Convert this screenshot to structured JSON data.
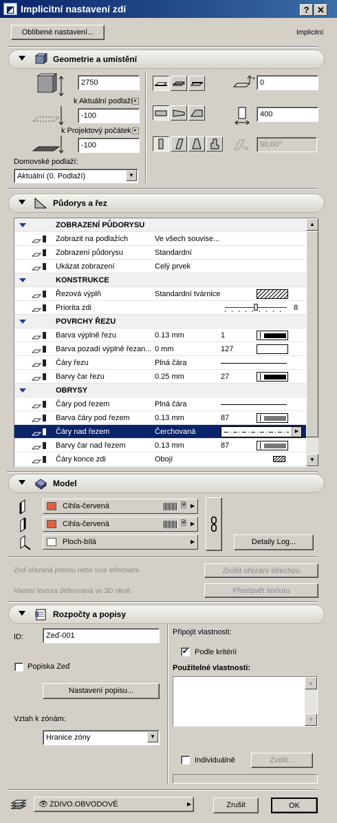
{
  "window": {
    "title": "Implicitní nastavení zdí",
    "help": "?",
    "close": "✕"
  },
  "top": {
    "favorites_label": "Oblíbené nastavení...",
    "mode": "Implicitní"
  },
  "sections": {
    "geometry": "Geometrie a umístění",
    "floorplan": "Půdorys a řez",
    "model": "Model",
    "budget": "Rozpočty a popisy"
  },
  "geometry": {
    "height": "2750",
    "top_link": "k Aktuální podlaží",
    "top_offset": "-100",
    "bottom_link": "k Projektový počátek",
    "bottom_offset": "-100",
    "home_story_label": "Domovské podlaží:",
    "home_story_value": "Aktuální (0. Podlaží)",
    "offset_value": "0",
    "thickness": "400",
    "angle": "90,00°"
  },
  "grid": {
    "rows": [
      {
        "type": "header",
        "name": "ZOBRAZENÍ PŮDORYSU"
      },
      {
        "type": "row",
        "name": "Zobrazit na podlažích",
        "value": "Ve všech souvise...",
        "icon": "stories-icon"
      },
      {
        "type": "row",
        "name": "Zobrazení půdorysu",
        "value": "Standardní",
        "icon": "view-icon"
      },
      {
        "type": "row",
        "name": "Ukázat zobrazení",
        "value": "Celý prvek",
        "icon": "show-icon"
      },
      {
        "type": "header",
        "name": "KONSTRUKCE"
      },
      {
        "type": "row",
        "name": "Řezová výplň",
        "value": "Standardní tvárnice",
        "icon": "hatch-icon",
        "swatch": "hatch"
      },
      {
        "type": "row",
        "name": "Priorita zdi",
        "value": "",
        "icon": "priority-icon",
        "extra": "8",
        "slider": true
      },
      {
        "type": "header",
        "name": "POVRCHY ŘEZU"
      },
      {
        "type": "row",
        "name": "Barva výplně řezu",
        "value": "0.13 mm",
        "extra": "1",
        "icon": "pen-icon",
        "swatch": "bar"
      },
      {
        "type": "row",
        "name": "Barva pozadí výplně řezan...",
        "value": "0 mm",
        "extra": "127",
        "icon": "pen-icon",
        "swatch": "empty"
      },
      {
        "type": "row",
        "name": "Čáry řezu",
        "value": "Plná čára",
        "icon": "line-icon",
        "swatch": "line"
      },
      {
        "type": "row",
        "name": "Barvy čar řezu",
        "value": "0.25 mm",
        "extra": "27",
        "icon": "pen-icon",
        "swatch": "bar"
      },
      {
        "type": "header",
        "name": "OBRYSY"
      },
      {
        "type": "row",
        "name": "Čáry pod řezem",
        "value": "Plná čára",
        "icon": "line-icon",
        "swatch": "line"
      },
      {
        "type": "row",
        "name": "Barva čáry pod řezem",
        "value": "0.13 mm",
        "extra": "87",
        "icon": "pen-icon",
        "swatch": "gray"
      },
      {
        "type": "row",
        "name": "Čáry nad řezem",
        "value": "Čerchovaná",
        "icon": "line-icon",
        "swatch": "dash",
        "selected": true
      },
      {
        "type": "row",
        "name": "Barvy čar nad řezem",
        "value": "0.13 mm",
        "extra": "87",
        "icon": "pen-icon",
        "swatch": "gray"
      },
      {
        "type": "row",
        "name": "Čáry konce zdi",
        "value": "Obojí",
        "icon": "end-icon",
        "swatch": "endsym"
      }
    ]
  },
  "model": {
    "materials": [
      {
        "name": "Cihla-červená",
        "color": "#e2603f",
        "icon": "wall-side-left-icon"
      },
      {
        "name": "Cihla-červená",
        "color": "#e2603f",
        "icon": "wall-side-right-icon"
      },
      {
        "name": "Ploch-bílá",
        "color": "#ffffff",
        "icon": "wall-edge-icon"
      }
    ],
    "log_details": "Detaily Log...",
    "roof_trim_note": "Zeď ořezaná jednou nebo více střechami.",
    "roof_trim_btn": "Zrušit ořezání střechou",
    "texture_note": "Vlastní textura definovaná ve 3D okně.",
    "texture_btn": "Přestavět texturu"
  },
  "budget": {
    "id_label": "ID:",
    "id_value": "Zeď-001",
    "label_checkbox": "Popiska Zeď",
    "label_settings": "Nastavení popisu...",
    "zone_relation_label": "Vztah k zónám:",
    "zone_relation_value": "Hranice zóny",
    "attach_props": "Připojit vlastnosti:",
    "by_criteria": "Podle kritérií",
    "available_props": "Použitelné vlastnosti:",
    "individual": "Individuálně",
    "choose": "Zvolit..."
  },
  "footer": {
    "layer": "ZDIVO.OBVODOVÉ",
    "cancel": "Zrušit",
    "ok": "OK"
  }
}
